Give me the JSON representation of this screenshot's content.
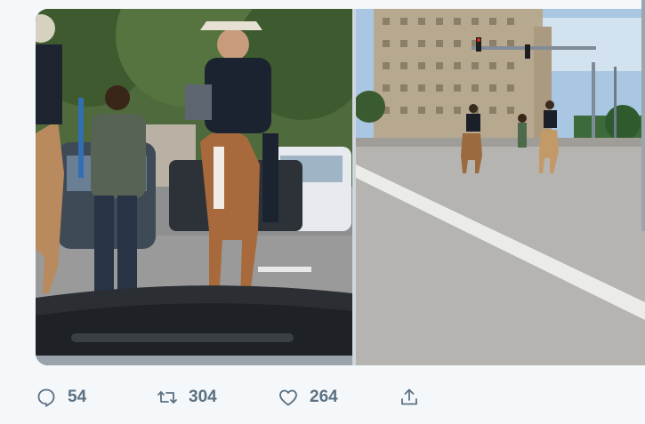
{
  "media": {
    "photos": [
      {
        "name": "photo-mounted-officers-downtown-closeup",
        "kind": "photo"
      },
      {
        "name": "photo-mounted-officers-street-wide",
        "kind": "photo"
      }
    ]
  },
  "actions": {
    "reply": {
      "icon": "reply-icon",
      "count": "54"
    },
    "retweet": {
      "icon": "retweet-icon",
      "count": "304"
    },
    "like": {
      "icon": "heart-icon",
      "count": "264"
    },
    "share": {
      "icon": "share-icon"
    }
  },
  "colors": {
    "action_gray": "#5b7083",
    "background": "#f5f8fa"
  }
}
